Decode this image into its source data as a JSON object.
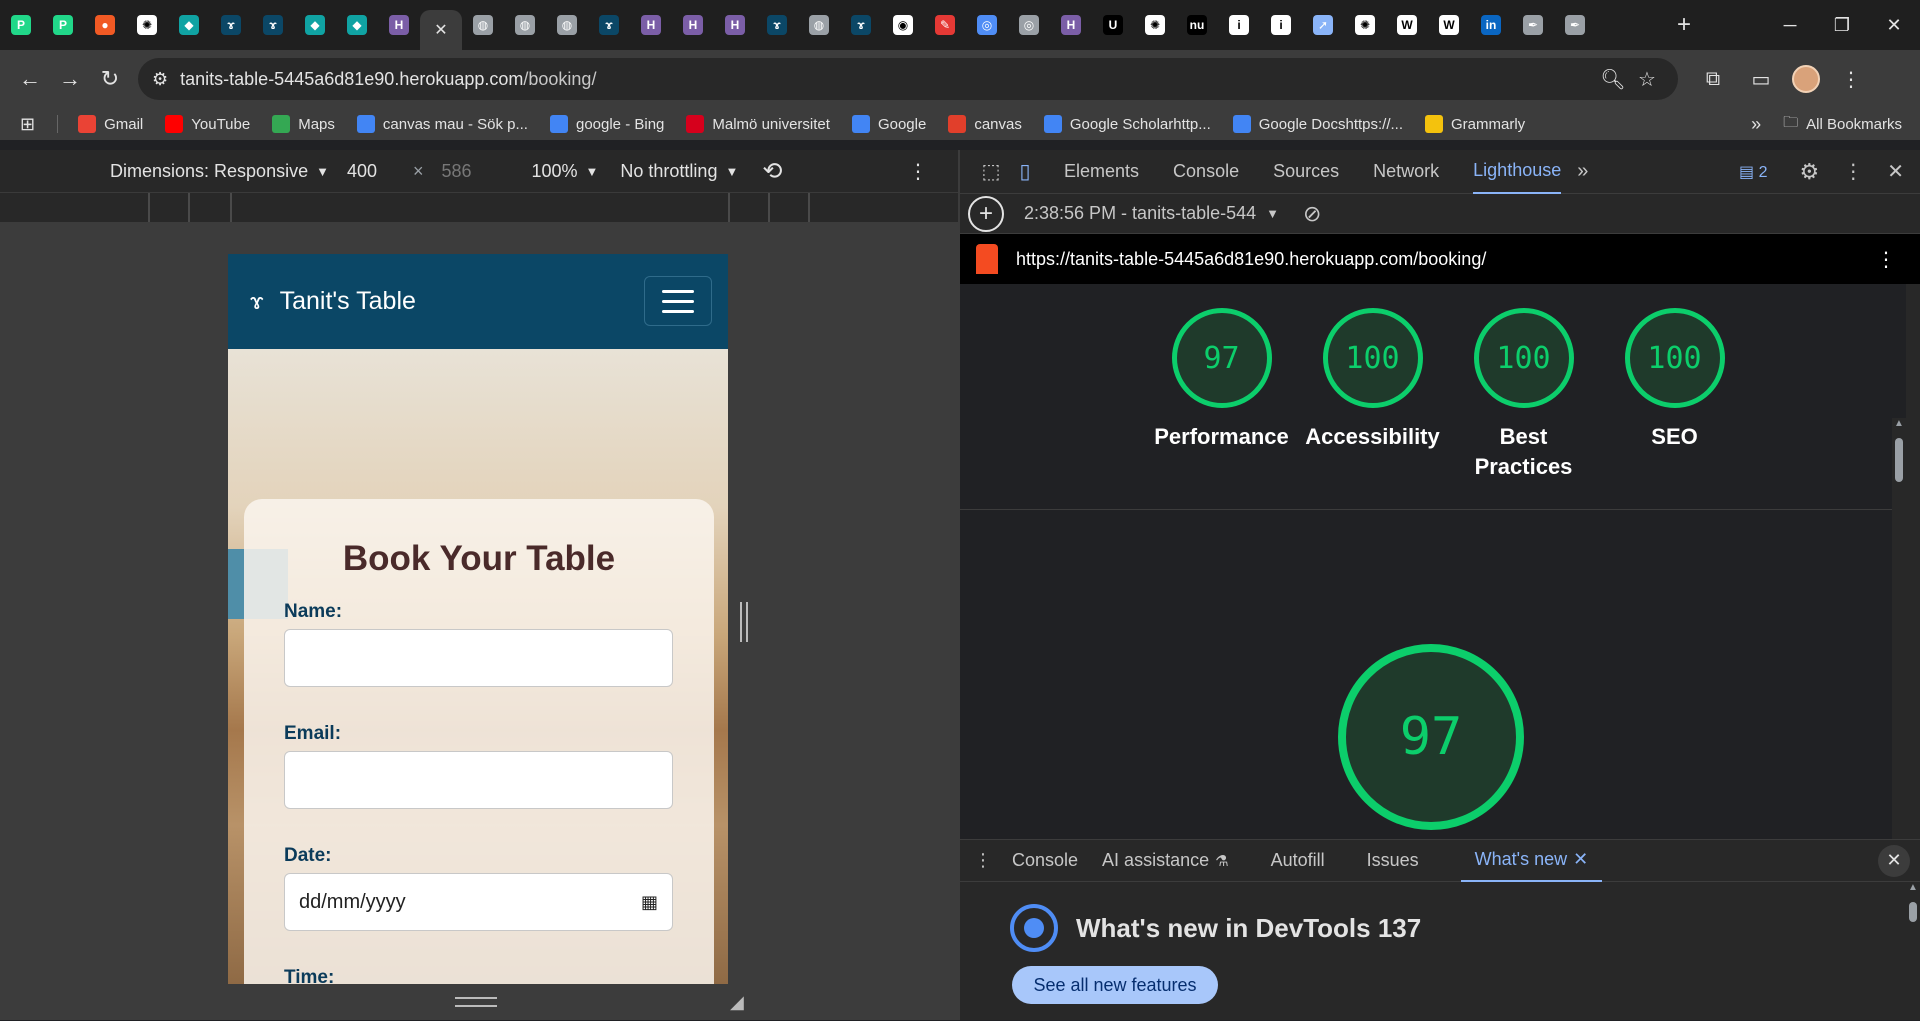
{
  "browser": {
    "tabs": [
      {
        "icon": "pycharm-icon",
        "color": "#21d789"
      },
      {
        "icon": "pycharm-icon",
        "color": "#21d789"
      },
      {
        "icon": "record-icon",
        "color": "#f15a24"
      },
      {
        "icon": "chatgpt-icon",
        "color": "#ffffff"
      },
      {
        "icon": "diamond-icon",
        "color": "#10a3a3"
      },
      {
        "icon": "heroku-app-icon",
        "color": "#0b4766"
      },
      {
        "icon": "heroku-app-icon",
        "color": "#0b4766"
      },
      {
        "icon": "diamond-icon",
        "color": "#10a3a3"
      },
      {
        "icon": "diamond-icon",
        "color": "#10a3a3"
      },
      {
        "icon": "heroku-icon",
        "color": "#7b5ea7"
      },
      {
        "icon": "close-icon",
        "color": "#3c3c3c",
        "active": true
      },
      {
        "icon": "globe-icon",
        "color": "#9aa0a6"
      },
      {
        "icon": "globe-icon",
        "color": "#9aa0a6"
      },
      {
        "icon": "globe-icon",
        "color": "#9aa0a6"
      },
      {
        "icon": "heroku-app-icon",
        "color": "#0b4766"
      },
      {
        "icon": "heroku-icon",
        "color": "#7b5ea7"
      },
      {
        "icon": "heroku-icon",
        "color": "#7b5ea7"
      },
      {
        "icon": "heroku-icon",
        "color": "#7b5ea7"
      },
      {
        "icon": "heroku-app-icon",
        "color": "#0b4766"
      },
      {
        "icon": "globe-icon",
        "color": "#9aa0a6"
      },
      {
        "icon": "heroku-app-icon",
        "color": "#0b4766"
      },
      {
        "icon": "github-icon",
        "color": "#ffffff"
      },
      {
        "icon": "pen-icon",
        "color": "#e53935"
      },
      {
        "icon": "chrome-icon",
        "color": "#4f8df5"
      },
      {
        "icon": "chrome-icon",
        "color": "#9aa0a6"
      },
      {
        "icon": "heroku-icon",
        "color": "#7b5ea7"
      },
      {
        "icon": "udemy-icon",
        "color": "#000000"
      },
      {
        "icon": "chatgpt-icon",
        "color": "#ffffff"
      },
      {
        "icon": "nu-icon",
        "color": "#000000"
      },
      {
        "icon": "info-icon",
        "color": "#ffffff"
      },
      {
        "icon": "info-icon",
        "color": "#ffffff"
      },
      {
        "icon": "rocket-icon",
        "color": "#8ab4f8"
      },
      {
        "icon": "chatgpt-icon",
        "color": "#ffffff"
      },
      {
        "icon": "wiki-icon",
        "color": "#ffffff"
      },
      {
        "icon": "wiki-icon",
        "color": "#ffffff"
      },
      {
        "icon": "linkedin-icon",
        "color": "#0a66c2"
      },
      {
        "icon": "pen-tool-icon",
        "color": "#9aa0a6"
      },
      {
        "icon": "pen-tool-icon",
        "color": "#9aa0a6"
      }
    ],
    "url_host": "tanits-table-5445a6d81e90.herokuapp.com",
    "url_path": "/booking/",
    "bookmarks": [
      {
        "label": "Gmail",
        "icon": "gmail-icon",
        "color": "#ea4335"
      },
      {
        "label": "YouTube",
        "icon": "youtube-icon",
        "color": "#ff0000"
      },
      {
        "label": "Maps",
        "icon": "maps-icon",
        "color": "#34a853"
      },
      {
        "label": "canvas mau - Sök p...",
        "icon": "google-icon",
        "color": "#4285f4"
      },
      {
        "label": "google - Bing",
        "icon": "search-icon",
        "color": "#4285f4"
      },
      {
        "label": "Malmö universitet",
        "icon": "mau-icon",
        "color": "#d6001c"
      },
      {
        "label": "Google",
        "icon": "google-icon",
        "color": "#4285f4"
      },
      {
        "label": "canvas",
        "icon": "canvas-icon",
        "color": "#e13f2b"
      },
      {
        "label": "Google Scholarhttp...",
        "icon": "scholar-icon",
        "color": "#4285f4"
      },
      {
        "label": "Google Docshttps://...",
        "icon": "docs-icon",
        "color": "#4285f4"
      },
      {
        "label": "Grammarly",
        "icon": "grammarly-icon",
        "color": "#f4c20d"
      }
    ],
    "all_bookmarks": "All Bookmarks"
  },
  "device_toolbar": {
    "dimensions": "Dimensions: Responsive",
    "width": "400",
    "height": "586",
    "zoom": "100%",
    "throttling": "No throttling"
  },
  "site": {
    "brand": "Tanit's Table",
    "heading": "Book Your Table",
    "fields": [
      {
        "label": "Name:",
        "value": ""
      },
      {
        "label": "Email:",
        "value": ""
      },
      {
        "label": "Date:",
        "value": "dd/mm/yyyy"
      },
      {
        "label": "Time:",
        "value": ""
      }
    ]
  },
  "devtools": {
    "tabs": [
      "Elements",
      "Console",
      "Sources",
      "Network",
      "Lighthouse"
    ],
    "active_tab": "Lighthouse",
    "issues_count": "2",
    "report_selector": "2:38:56 PM - tanits-table-544",
    "report_url": "https://tanits-table-5445a6d81e90.herokuapp.com/booking/",
    "scores": [
      {
        "value": "97",
        "label": "Performance"
      },
      {
        "value": "100",
        "label": "Accessibility"
      },
      {
        "value": "100",
        "label": "Best Practices"
      },
      {
        "value": "100",
        "label": "SEO"
      }
    ],
    "big_score": "97",
    "drawer_tabs": [
      "Console",
      "AI assistance",
      "Autofill",
      "Issues",
      "What's new"
    ],
    "whats_new_title": "What's new in DevTools 137",
    "whats_new_button": "See all new features"
  }
}
